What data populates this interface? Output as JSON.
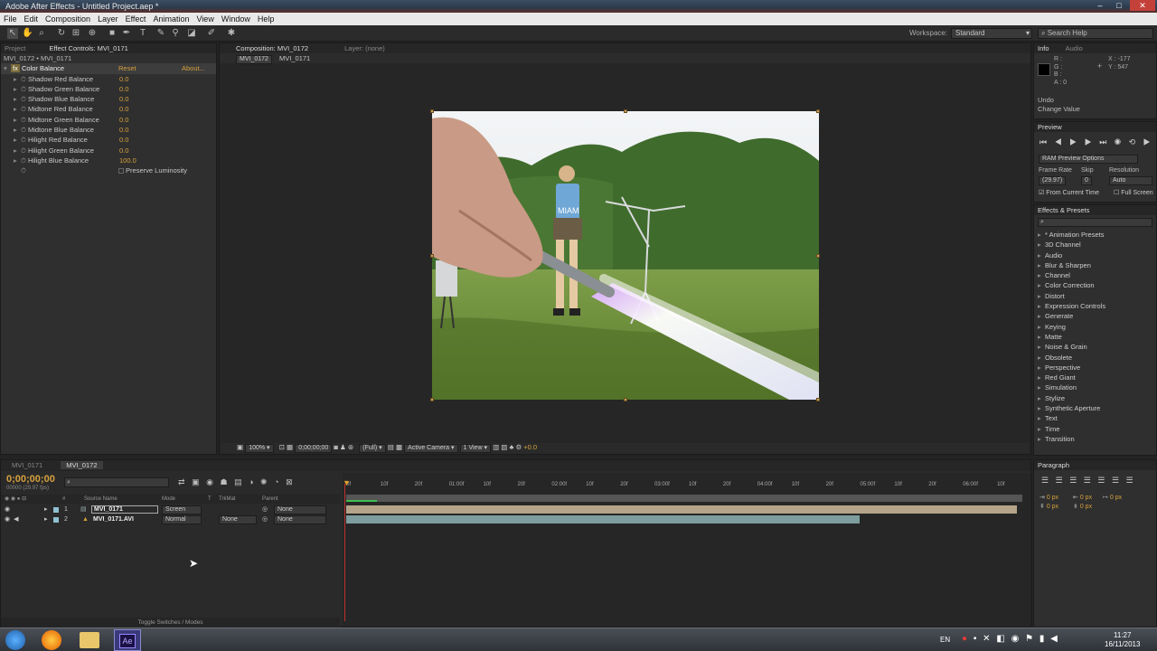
{
  "app": {
    "title": "Adobe After Effects - Untitled Project.aep *",
    "window_controls": [
      "–",
      "□",
      "✕"
    ]
  },
  "menu": [
    "File",
    "Edit",
    "Composition",
    "Layer",
    "Effect",
    "Animation",
    "View",
    "Window",
    "Help"
  ],
  "toolbar": {
    "workspace_label": "Workspace:",
    "workspace_value": "Standard",
    "search_placeholder": "Search Help"
  },
  "effect_controls": {
    "tabs": [
      "Project",
      "Effect Controls: MVI_0171"
    ],
    "breadcrumb": "MVI_0172 • MVI_0171",
    "effect_name": "Color Balance",
    "reset": "Reset",
    "about": "About...",
    "params": [
      {
        "label": "Shadow Red Balance",
        "value": "0.0"
      },
      {
        "label": "Shadow Green Balance",
        "value": "0.0"
      },
      {
        "label": "Shadow Blue Balance",
        "value": "0.0"
      },
      {
        "label": "Midtone Red Balance",
        "value": "0.0"
      },
      {
        "label": "Midtone Green Balance",
        "value": "0.0"
      },
      {
        "label": "Midtone Blue Balance",
        "value": "0.0"
      },
      {
        "label": "Hilight Red Balance",
        "value": "0.0"
      },
      {
        "label": "Hilight Green Balance",
        "value": "0.0"
      },
      {
        "label": "Hilight Blue Balance",
        "value": "100.0"
      }
    ],
    "preserve_luminosity": "Preserve Luminosity"
  },
  "composition": {
    "tabs": [
      "Composition: MVI_0172",
      "Layer: (none)"
    ],
    "crumbs": [
      "MVI_0172",
      "MVI_0171"
    ],
    "image_text": "MIAM",
    "footer": {
      "zoom": "100%",
      "timecode": "0;00;00;00",
      "resolution": "(Full)",
      "camera": "Active Camera",
      "view": "1 View",
      "exposure": "+0.0"
    }
  },
  "info": {
    "tabs": [
      "Info",
      "Audio"
    ],
    "channels": [
      "R :",
      "G :",
      "B :",
      "A : 0"
    ],
    "x": "X : -177",
    "y": "Y : 547",
    "undo": "Undo",
    "action": "Change Value"
  },
  "preview": {
    "tab": "Preview",
    "options": "RAM Preview Options",
    "frame_rate_label": "Frame Rate",
    "skip_label": "Skip",
    "resolution_label": "Resolution",
    "frame_rate_value": "(29.97)",
    "skip_value": "0",
    "resolution_value": "Auto",
    "from_current": "From Current Time",
    "full_screen": "Full Screen"
  },
  "effects_presets": {
    "tab": "Effects & Presets",
    "items": [
      "* Animation Presets",
      "3D Channel",
      "Audio",
      "Blur & Sharpen",
      "Channel",
      "Color Correction",
      "Distort",
      "Expression Controls",
      "Generate",
      "Keying",
      "Matte",
      "Noise & Grain",
      "Obsolete",
      "Perspective",
      "Red Giant",
      "Simulation",
      "Stylize",
      "Synthetic Aperture",
      "Text",
      "Time",
      "Transition"
    ]
  },
  "timeline": {
    "tabs": [
      "MVI_0171",
      "MVI_0172"
    ],
    "timecode": "0;00;00;00",
    "fps": "00000 (29.97 fps)",
    "headers": {
      "num": "#",
      "source": "Source Name",
      "mode": "Mode",
      "t": "T",
      "trkmat": "TrkMat",
      "parent": "Parent"
    },
    "layers": [
      {
        "num": "1",
        "name": "MVI_0171",
        "mode": "Screen",
        "trkmat": "",
        "parent": "None"
      },
      {
        "num": "2",
        "name": "MVI_0171.AVI",
        "mode": "Normal",
        "trkmat": "None",
        "parent": "None"
      }
    ],
    "ruler": [
      "0f",
      "10f",
      "20f",
      "01:00f",
      "10f",
      "20f",
      "02:00f",
      "10f",
      "20f",
      "03:00f",
      "10f",
      "20f",
      "04:00f",
      "10f",
      "20f",
      "05:00f",
      "10f",
      "20f",
      "06:00f",
      "10f"
    ],
    "toggle": "Toggle Switches / Modes"
  },
  "paragraph": {
    "tab": "Paragraph",
    "values": [
      "0 px",
      "0 px",
      "0 px",
      "0 px",
      "0 px"
    ]
  },
  "taskbar": {
    "lang": "EN",
    "time": "11:27",
    "date": "16/11/2013",
    "ae_label": "Ae"
  },
  "colors": {
    "accent_orange": "#d6a13d",
    "value_blue": "#3d8fd6",
    "panel_bg": "#2f2f2f"
  }
}
